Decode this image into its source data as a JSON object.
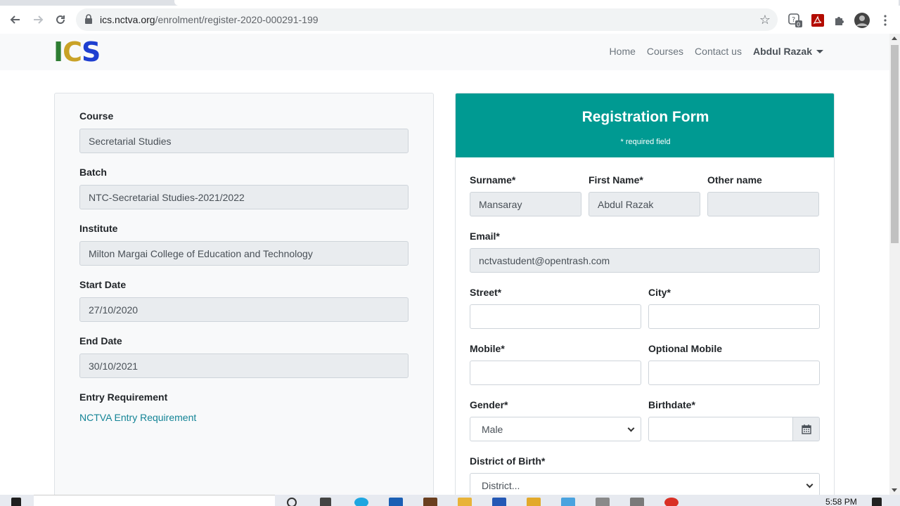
{
  "browser": {
    "url_host": "ics.nctva.org",
    "url_path": "/enrolment/register-2020-000291-199",
    "ext_badge": "0"
  },
  "navbar": {
    "logo": {
      "i": "I",
      "c": "C",
      "s": "S"
    },
    "links": [
      "Home",
      "Courses",
      "Contact us"
    ],
    "user": "Abdul Razak"
  },
  "course_info": {
    "course_label": "Course",
    "course_value": "Secretarial Studies",
    "batch_label": "Batch",
    "batch_value": "NTC-Secretarial Studies-2021/2022",
    "institute_label": "Institute",
    "institute_value": "Milton Margai College of Education and Technology",
    "start_label": "Start Date",
    "start_value": "27/10/2020",
    "end_label": "End Date",
    "end_value": "30/10/2021",
    "entry_label": "Entry Requirement",
    "entry_link": "NCTVA Entry Requirement"
  },
  "form": {
    "title": "Registration Form",
    "subtitle": "* required field",
    "surname_label": "Surname*",
    "surname_value": "Mansaray",
    "firstname_label": "First Name*",
    "firstname_value": "Abdul Razak",
    "othername_label": "Other name",
    "othername_value": "",
    "email_label": "Email*",
    "email_value": "nctvastudent@opentrash.com",
    "street_label": "Street*",
    "street_value": "",
    "city_label": "City*",
    "city_value": "",
    "mobile_label": "Mobile*",
    "mobile_value": "",
    "optmobile_label": "Optional Mobile",
    "optmobile_value": "",
    "gender_label": "Gender*",
    "gender_value": "Male",
    "birthdate_label": "Birthdate*",
    "birthdate_value": "",
    "district_label": "District of Birth*",
    "district_value": "District..."
  },
  "taskbar": {
    "time": "5:58 PM"
  },
  "colors": {
    "accent": "#009a92",
    "link": "#138496"
  }
}
